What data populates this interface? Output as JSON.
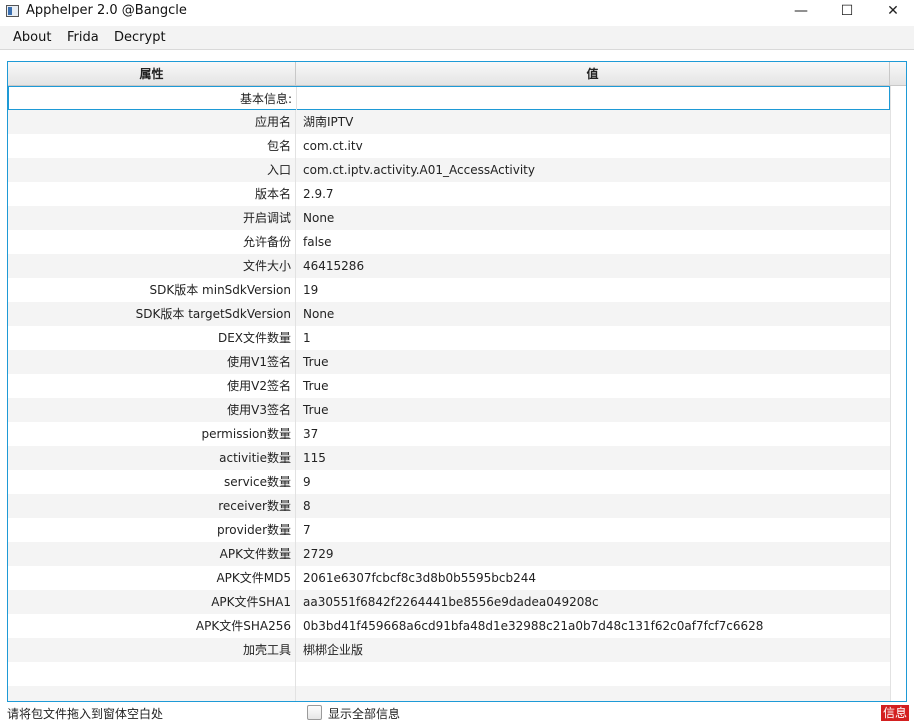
{
  "window": {
    "title": "Apphelper 2.0 @Bangcle",
    "minimize_glyph": "—",
    "maximize_glyph": "☐",
    "close_glyph": "✕"
  },
  "menu": [
    "About",
    "Frida",
    "Decrypt"
  ],
  "table": {
    "columns": [
      "属性",
      "值"
    ],
    "rows": [
      {
        "key": "基本信息:",
        "value": ""
      },
      {
        "key": "应用名",
        "value": "湖南IPTV"
      },
      {
        "key": "包名",
        "value": "com.ct.itv"
      },
      {
        "key": "入口",
        "value": "com.ct.iptv.activity.A01_AccessActivity"
      },
      {
        "key": "版本名",
        "value": "2.9.7"
      },
      {
        "key": "开启调试",
        "value": "None"
      },
      {
        "key": "允许备份",
        "value": "false"
      },
      {
        "key": "文件大小",
        "value": "46415286"
      },
      {
        "key": "SDK版本 minSdkVersion",
        "value": "19"
      },
      {
        "key": "SDK版本 targetSdkVersion",
        "value": "None"
      },
      {
        "key": "DEX文件数量",
        "value": "1"
      },
      {
        "key": "使用V1签名",
        "value": "True"
      },
      {
        "key": "使用V2签名",
        "value": "True"
      },
      {
        "key": "使用V3签名",
        "value": "True"
      },
      {
        "key": "permission数量",
        "value": "37"
      },
      {
        "key": "activitie数量",
        "value": "115"
      },
      {
        "key": "service数量",
        "value": "9"
      },
      {
        "key": "receiver数量",
        "value": "8"
      },
      {
        "key": "provider数量",
        "value": "7"
      },
      {
        "key": "APK文件数量",
        "value": "2729"
      },
      {
        "key": "APK文件MD5",
        "value": "2061e6307fcbcf8c3d8b0b5595bcb244"
      },
      {
        "key": "APK文件SHA1",
        "value": "aa30551f6842f2264441be8556e9dadea049208c"
      },
      {
        "key": "APK文件SHA256",
        "value": "0b3bd41f459668a6cd91bfa48d1e32988c21a0b7d48c131f62c0af7fcf7c6628"
      },
      {
        "key": "加壳工具",
        "value": "梆梆企业版"
      }
    ]
  },
  "status": {
    "hint": "请将包文件拖入到窗体空白处",
    "show_all_label": "显示全部信息",
    "info_badge": "信息"
  },
  "colors": {
    "accent": "#1e9ad6",
    "badge": "#d32020"
  }
}
